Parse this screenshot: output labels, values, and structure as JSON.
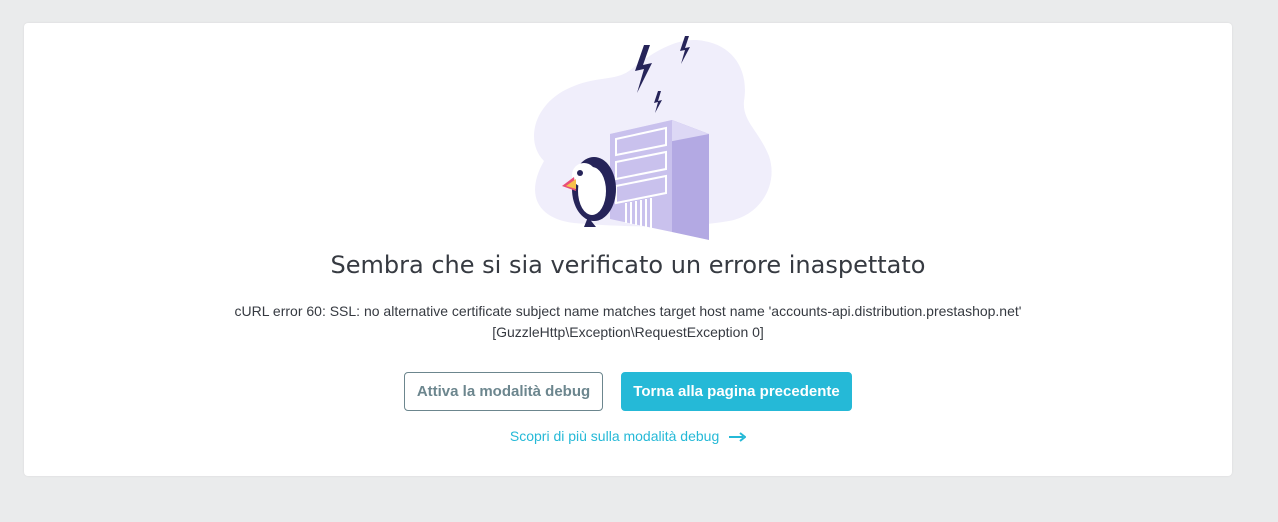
{
  "error_page": {
    "title": "Sembra che si sia verificato un errore inaspettato",
    "message_line1": "cURL error 60: SSL: no alternative certificate subject name matches target host name 'accounts-api.distribution.prestashop.net'",
    "message_line2": "[GuzzleHttp\\Exception\\RequestException 0]",
    "debug_button_label": "Attiva la modalità debug",
    "back_button_label": "Torna alla pagina precedente",
    "learn_more_label": "Scopri di più sulla modalità debug",
    "illustration_icon": "puffin-server-error-illustration",
    "arrow_icon": "arrow-right-icon"
  },
  "colors": {
    "page_background": "#eaebec",
    "card_background": "#ffffff",
    "primary": "#25b9d7",
    "secondary": "#6c868e",
    "text": "#363a41",
    "blob": "#f0eefb",
    "server": "#c9c1ed",
    "lightning": "#262459"
  }
}
